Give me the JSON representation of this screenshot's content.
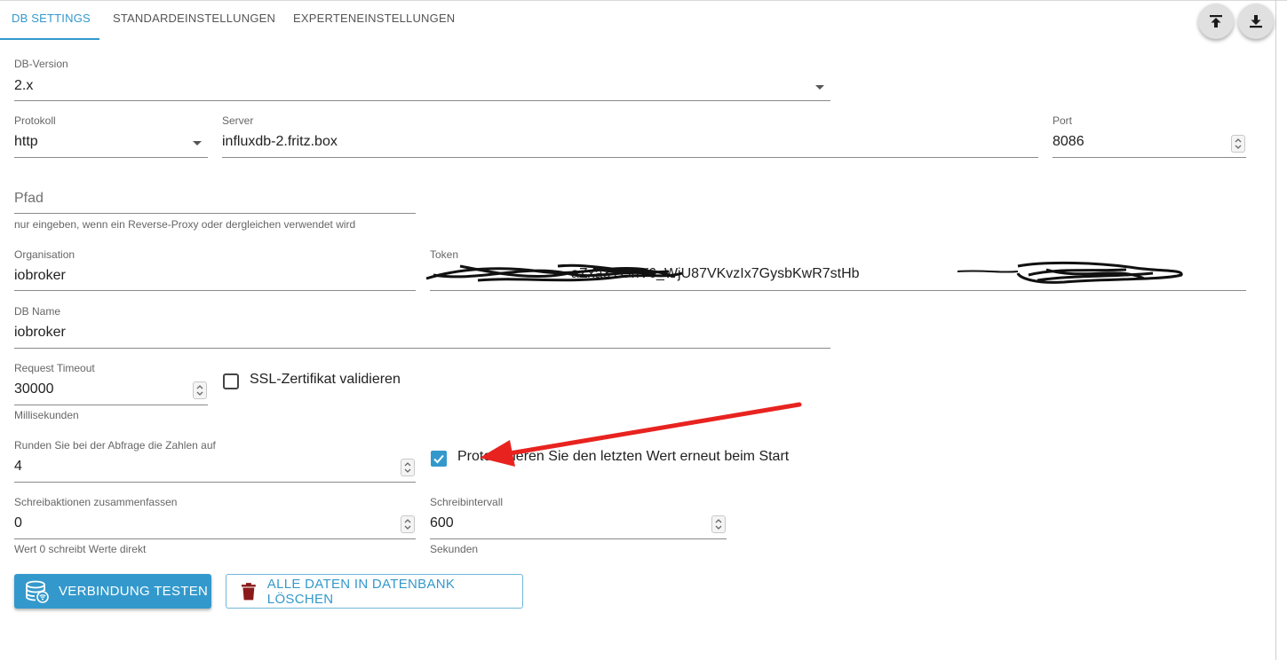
{
  "tabs": [
    {
      "label": "DB SETTINGS",
      "active": true
    },
    {
      "label": "STANDARDEINSTELLUNGEN",
      "active": false
    },
    {
      "label": "EXPERTENEINSTELLUNGEN",
      "active": false
    }
  ],
  "toolbar": {
    "upload_icon": "upload-icon",
    "download_icon": "download-icon"
  },
  "db_version": {
    "label": "DB-Version",
    "value": "2.x"
  },
  "protocol": {
    "label": "Protokoll",
    "value": "http"
  },
  "server": {
    "label": "Server",
    "value": "influxdb-2.fritz.box"
  },
  "port": {
    "label": "Port",
    "value": "8086"
  },
  "path": {
    "placeholder": "Pfad",
    "helper": "nur eingeben, wenn ein Reverse-Proxy oder dergleichen verwendet wird"
  },
  "organisation": {
    "label": "Organisation",
    "value": "iobroker"
  },
  "token": {
    "label": "Token",
    "value": "aZxa3YGhV6_WjU87VKvzIx7GysbKwR7stHb"
  },
  "db_name": {
    "label": "DB Name",
    "value": "iobroker"
  },
  "request_timeout": {
    "label": "Request Timeout",
    "value": "30000",
    "helper": "Millisekunden"
  },
  "ssl_checkbox": {
    "label": "SSL-Zertifikat validieren",
    "checked": false
  },
  "round": {
    "label": "Runden Sie bei der Abfrage die Zahlen auf",
    "value": "4"
  },
  "log_last_checkbox": {
    "label": "Protokollieren Sie den letzten Wert erneut beim Start",
    "checked": true
  },
  "write_batch": {
    "label": "Schreibaktionen zusammenfassen",
    "value": "0",
    "helper": "Wert 0 schreibt Werte direkt"
  },
  "write_interval": {
    "label": "Schreibintervall",
    "value": "600",
    "helper": "Sekunden"
  },
  "buttons": {
    "test": "VERBINDUNG TESTEN",
    "delete": "ALLE DATEN IN DATENBANK LÖSCHEN"
  },
  "colors": {
    "accent": "#3399cc",
    "annotation_arrow": "#e8231f",
    "delete_icon": "#8b1a1a"
  }
}
